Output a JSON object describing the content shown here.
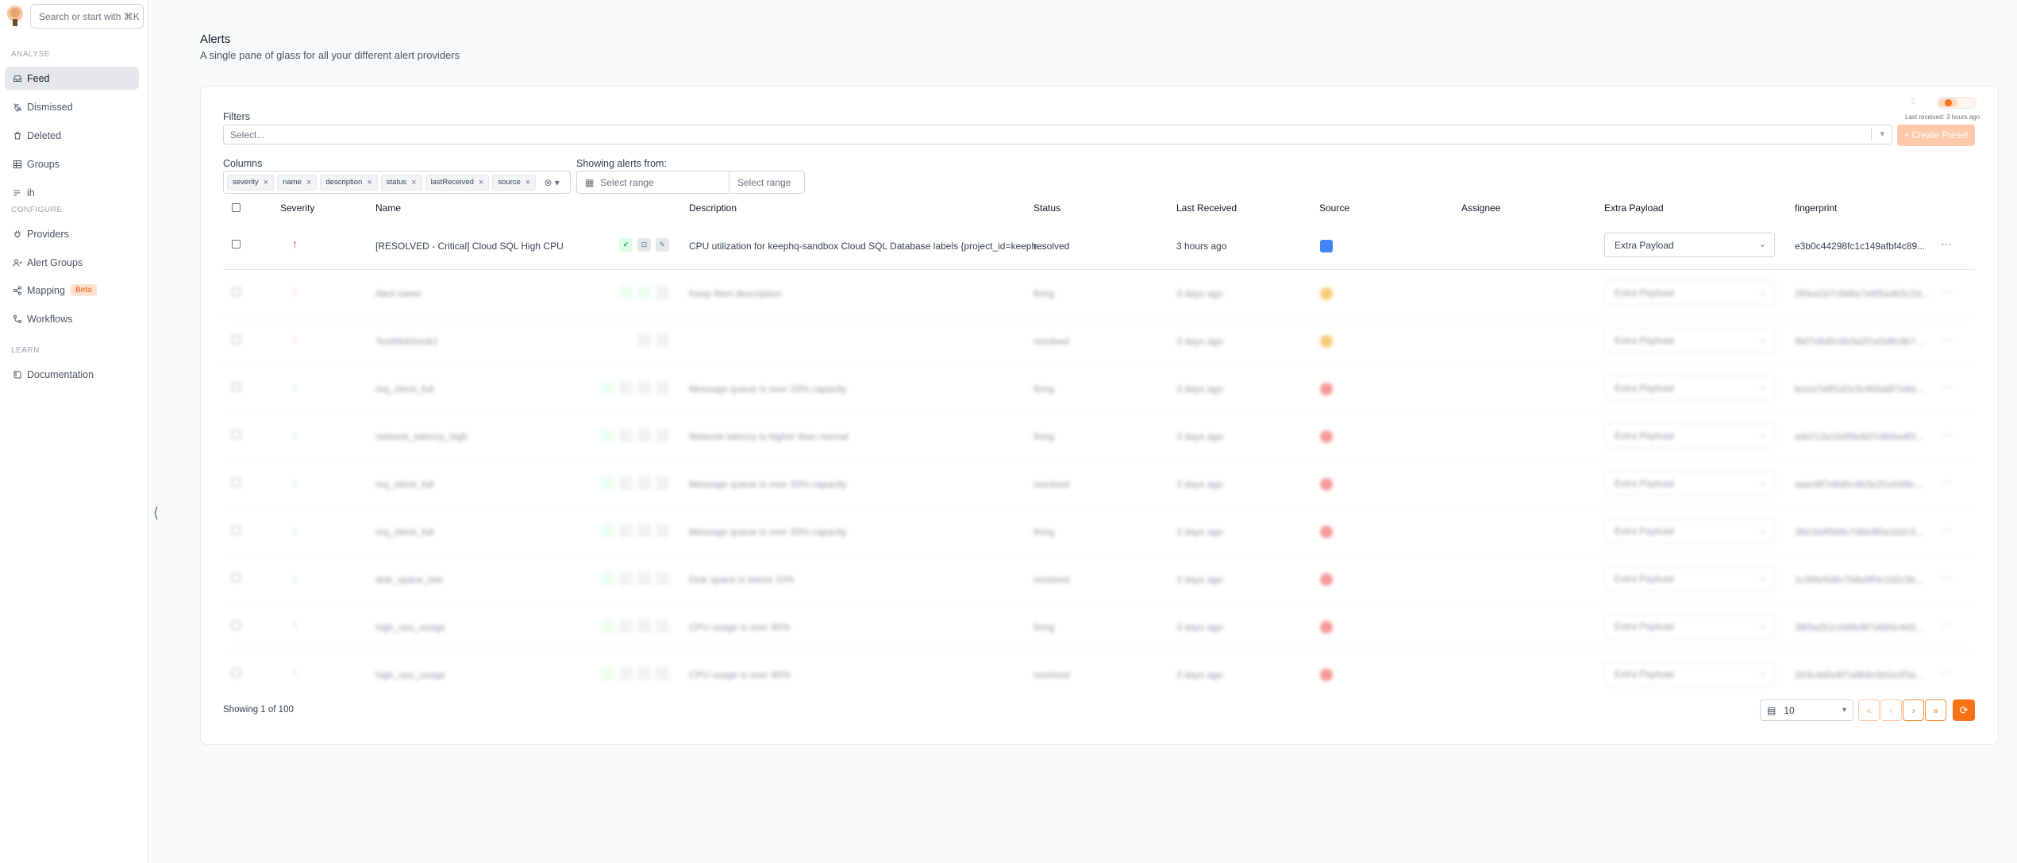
{
  "sidebar": {
    "search_placeholder": "Search or start with ⌘K",
    "sections": {
      "analyse": "ANALYSE",
      "configure": "CONFIGURE",
      "learn": "LEARN"
    },
    "analyse_items": [
      {
        "label": "Feed",
        "icon": "inbox-icon",
        "active": true
      },
      {
        "label": "Dismissed",
        "icon": "bell-off-icon"
      },
      {
        "label": "Deleted",
        "icon": "trash-icon"
      },
      {
        "label": "Groups",
        "icon": "grid-icon"
      },
      {
        "label": "ih",
        "icon": "sliders-icon"
      }
    ],
    "configure_items": [
      {
        "label": "Providers",
        "icon": "plug-icon"
      },
      {
        "label": "Alert Groups",
        "icon": "users-icon"
      },
      {
        "label": "Mapping",
        "icon": "share-icon",
        "badge": "Beta"
      },
      {
        "label": "Workflows",
        "icon": "workflow-icon"
      }
    ],
    "learn_items": [
      {
        "label": "Documentation",
        "icon": "book-icon"
      }
    ]
  },
  "header": {
    "title": "Alerts",
    "subtitle": "A single pane of glass for all your different alert providers"
  },
  "panel": {
    "last_received": "Last received: 3 hours ago",
    "filters_label": "Filters",
    "filters_placeholder": "Select...",
    "create_preset": "+ Create Preset",
    "columns_label": "Columns",
    "columns_chips": [
      "severity",
      "name",
      "description",
      "status",
      "lastReceived",
      "source"
    ],
    "showing_from_label": "Showing alerts from:",
    "range_from": "Select range",
    "range_to": "Select range"
  },
  "table": {
    "headers": {
      "severity": "Severity",
      "name": "Name",
      "description": "Description",
      "status": "Status",
      "last_received": "Last Received",
      "source": "Source",
      "assignee": "Assignee",
      "extra_payload": "Extra Payload",
      "fingerprint": "fingerprint"
    },
    "rows": [
      {
        "name": "[RESOLVED - Critical] Cloud SQL High CPU",
        "description": "CPU utilization for keephq-sandbox Cloud SQL Database labels {project_id=keeph...",
        "status": "resolved",
        "last_received": "3 hours ago",
        "payload": "Extra Payload",
        "fingerprint": "e3b0c44298fc1c149afbf4c89..."
      },
      {
        "name": "Alert name",
        "description": "Keep Alert description",
        "status": "firing",
        "last_received": "3 days ago",
        "payload": "Extra Payload",
        "fingerprint": "2f0ea1b7c9d8a7e6f5a4b3c2d..."
      },
      {
        "name": "TestWebhook1",
        "description": "",
        "status": "resolved",
        "last_received": "3 days ago",
        "payload": "Extra Payload",
        "fingerprint": "9bf7e6d5c4b3a2f1e0d9c8b7..."
      },
      {
        "name": "mq_client_full",
        "description": "Message queue is over 33% capacity",
        "status": "firing",
        "last_received": "3 days ago",
        "payload": "Extra Payload",
        "fingerprint": "bcea7a9f1d2e3c4b5a6f7e8d..."
      },
      {
        "name": "network_latency_high",
        "description": "Network latency is higher than normal",
        "status": "firing",
        "last_received": "3 days ago",
        "payload": "Extra Payload",
        "fingerprint": "a4d7c2e1b0f9e8d7c6b5a4f3..."
      },
      {
        "name": "mq_client_full",
        "description": "Message queue is over 33% capacity",
        "status": "resolved",
        "last_received": "3 days ago",
        "payload": "Extra Payload",
        "fingerprint": "aaec8f7e6d5c4b3a2f1e0d9c..."
      },
      {
        "name": "mq_client_full",
        "description": "Message queue is over 33% capacity",
        "status": "firing",
        "last_received": "3 days ago",
        "payload": "Extra Payload",
        "fingerprint": "38e3a4f5b6c7d8e9f0a1b2c3..."
      },
      {
        "name": "disk_space_low",
        "description": "Disk space is below 10%",
        "status": "resolved",
        "last_received": "3 days ago",
        "payload": "Extra Payload",
        "fingerprint": "1c3f4e5d6c7b8a9f0e1d2c3b..."
      },
      {
        "name": "high_cpu_usage",
        "description": "CPU usage is over 90%",
        "status": "firing",
        "last_received": "3 days ago",
        "payload": "Extra Payload",
        "fingerprint": "38f3a2b1c0d9e8f7a6b5c4d3..."
      },
      {
        "name": "high_cpu_usage",
        "description": "CPU usage is over 90%",
        "status": "resolved",
        "last_received": "3 days ago",
        "payload": "Extra Payload",
        "fingerprint": "2b3c4d5e6f7a8b9c0d1e2f3a..."
      }
    ]
  },
  "footer": {
    "showing": "Showing 1 of 100",
    "per_page": "10"
  },
  "colors": {
    "accent": "#f97316",
    "accent_light": "#fdc9a8"
  }
}
